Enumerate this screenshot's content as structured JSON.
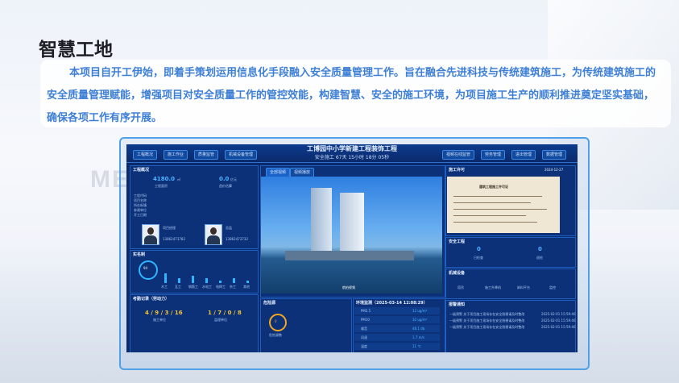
{
  "page": {
    "title": "智慧工地",
    "intro": "本项目自开工伊始，即着手策划运用信息化手段融入安全质量管理工作。旨在融合先进科技与传统建筑施工，为传统建筑施工的安全质量管理赋能，增强项目对安全质量工作的管控效能，构建智慧、安全的施工环境，为项目施工生产的顺利推进奠定坚实基础，确保各项工作有序开展。"
  },
  "dashboard": {
    "system_title": "工博园中小学新建工程装饰工程",
    "status_line": "安全施工 67天 15小时 18分 05秒",
    "nav_left": [
      "工程概况",
      "施工作业",
      "质量监管",
      "机械设备管理"
    ],
    "nav_right": [
      "视频在线监管",
      "劳务管理",
      "进出管理",
      "数据管理"
    ],
    "overview": {
      "title": "工程概况",
      "value1": "4180.0",
      "value1_unit": "㎡",
      "value1_label": "工程面积",
      "value2": "0.0",
      "value2_unit": "亿元",
      "value2_label": "造价估算",
      "fields": [
        "工程代码",
        "项目名称",
        "所在街镇",
        "参建单位",
        "开工日期"
      ],
      "person1_role": "项目经理",
      "person1_phone": "13862473782",
      "person2_role": "总监",
      "person2_phone": "13862473732"
    },
    "labor": {
      "title": "实名制",
      "ring_value": "94",
      "categories": [
        "木工",
        "瓦工",
        "钢筋工",
        "水电工",
        "电焊工",
        "杂工",
        "其他"
      ],
      "bars": [
        0.2,
        0.1,
        0.15,
        0.1,
        0.05,
        0.1,
        0.05
      ]
    },
    "inspection": {
      "title": "考勤记录（劳动力）",
      "left_value": "4 / 9 / 3 / 16",
      "left_label": "施工单位",
      "right_value": "1 / 7 / 0 / 8",
      "right_label": "监理单位"
    },
    "video": {
      "tab1": "全部视频",
      "tab2": "视频播放",
      "caption": "航拍视频"
    },
    "danger": {
      "title": "危险源",
      "ring_value": "0",
      "ring_label": "危险源数"
    },
    "environment": {
      "title": "环境监测（2025-03-14 12:08:29）",
      "rows": [
        {
          "name": "PM2.5",
          "value": "12 ug/m³"
        },
        {
          "name": "PM10",
          "value": "32 ug/m³"
        },
        {
          "name": "噪音",
          "value": "48.1 db"
        },
        {
          "name": "风速",
          "value": "1.7 m/s"
        },
        {
          "name": "温度",
          "value": "11 ℃"
        }
      ]
    },
    "permit": {
      "title": "施工许可",
      "date": "2024-12-27",
      "doc_title": "建筑工程施工许可证"
    },
    "safety": {
      "title": "安全工程",
      "left_value": "0",
      "left_label": "日检查",
      "right_value": "0",
      "right_label": "巡检"
    },
    "machinery": {
      "title": "机械设备",
      "items": [
        "塔吊",
        "施工升降机",
        "卸料平台",
        "监控"
      ]
    },
    "warnings": {
      "title": "报警通知",
      "rows": [
        {
          "text": "一级预警 关于项目施工现场存在安全隐患请及时整改",
          "time": "2025-02-01 15:59:46"
        },
        {
          "text": "一级预警 关于项目施工现场存在安全隐患请及时整改",
          "time": "2025-02-01 15:59:46"
        },
        {
          "text": "一级预警 关于项目施工现场存在安全隐患请及时整改",
          "time": "2025-02-01 15:59:46"
        }
      ]
    }
  }
}
